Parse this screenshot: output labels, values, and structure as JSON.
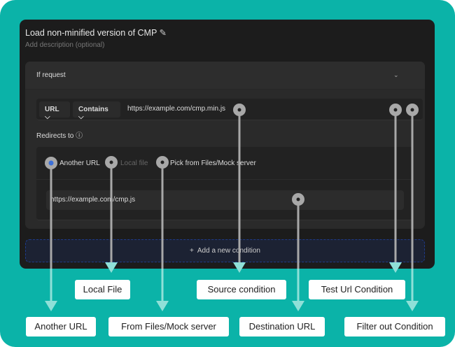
{
  "rule": {
    "title": "Load non-minified version of CMP",
    "description_placeholder": "Add description (optional)",
    "edit_icon": "pencil-icon"
  },
  "condition": {
    "header": "If request",
    "field": "URL",
    "operator": "Contains",
    "value": "https://example.com/cmp.min.js"
  },
  "redirect": {
    "label": "Redirects to",
    "options": [
      {
        "label": "Another URL",
        "selected": true
      },
      {
        "label": "Local file",
        "selected": false,
        "disabled": true
      },
      {
        "label": "Pick from Files/Mock server",
        "selected": false
      }
    ],
    "destination": "https://example.com/cmp.js"
  },
  "add_condition": "Add a new condition",
  "annotations": [
    "Local File",
    "Source condition",
    "Test Url Condition",
    "Another URL",
    "From Files/Mock server",
    "Destination URL",
    "Filter out Condition"
  ],
  "colors": {
    "background": "#0bb3a8",
    "panel": "#1c1c1c",
    "accent": "#3b6fd8",
    "callout_line": "#8fe0d8"
  }
}
